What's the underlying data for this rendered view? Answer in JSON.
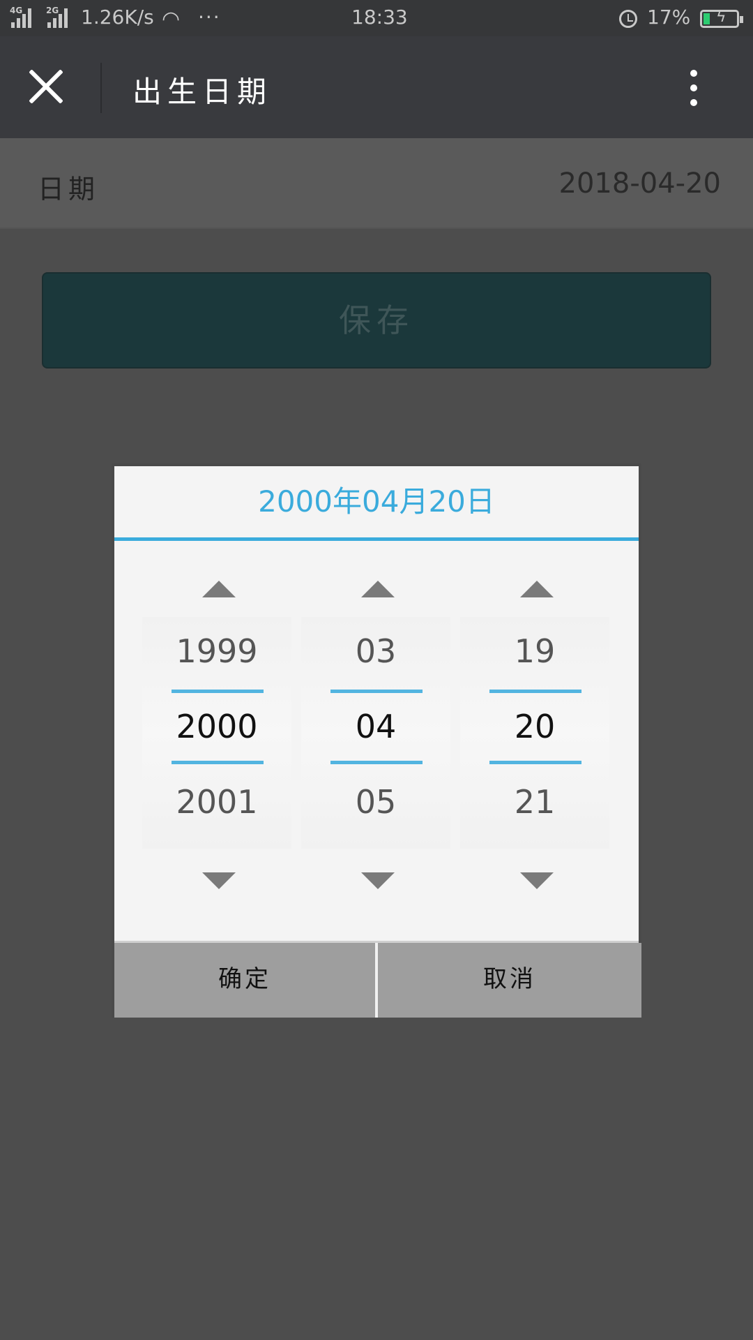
{
  "status_bar": {
    "network_1": "4G",
    "network_2": "2G",
    "speed": "1.26K/s",
    "dots": "···",
    "time": "18:33",
    "battery_percent": "17%",
    "battery_level": 0.17,
    "icons": [
      "signal-icon",
      "wifi-icon",
      "alarm-icon",
      "battery-icon"
    ]
  },
  "header": {
    "title": "出生日期",
    "close_icon": "close-icon",
    "more_icon": "more-vertical-icon"
  },
  "date_row": {
    "label": "日期",
    "value": "2018-04-20"
  },
  "save_button": "保存",
  "dialog": {
    "title": "2000年04月20日",
    "accent_color": "#3aabdc",
    "columns": [
      {
        "name": "year",
        "prev": "1999",
        "selected": "2000",
        "next": "2001"
      },
      {
        "name": "month",
        "prev": "03",
        "selected": "04",
        "next": "05"
      },
      {
        "name": "day",
        "prev": "19",
        "selected": "20",
        "next": "21"
      }
    ],
    "confirm": "确定",
    "cancel": "取消"
  }
}
